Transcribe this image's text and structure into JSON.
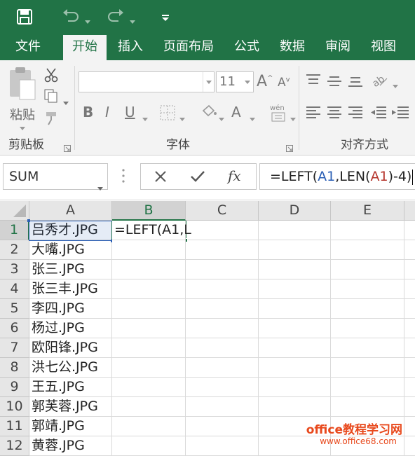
{
  "menu": {
    "tabs": [
      {
        "label": "文件"
      },
      {
        "label": "开始"
      },
      {
        "label": "插入"
      },
      {
        "label": "页面布局"
      },
      {
        "label": "公式"
      },
      {
        "label": "数据"
      },
      {
        "label": "审阅"
      },
      {
        "label": "视图"
      }
    ],
    "active": "开始"
  },
  "ribbon": {
    "clipboard": {
      "paste_label": "粘贴",
      "group_label": "剪贴板"
    },
    "font": {
      "font_name": "",
      "font_size": "11",
      "group_label": "字体"
    },
    "alignment": {
      "group_label": "对齐方式"
    }
  },
  "formula_bar": {
    "name_box": "SUM",
    "formula_parts": [
      "=LEFT(",
      "A1",
      ",LEN(",
      "A1",
      ")-4)"
    ]
  },
  "sheet": {
    "columns": [
      "A",
      "B",
      "C",
      "D",
      "E"
    ],
    "selected_column": "B",
    "rows": [
      {
        "num": "1",
        "a": "吕秀才.JPG",
        "b": "=LEFT(A1,L"
      },
      {
        "num": "2",
        "a": "大嘴.JPG",
        "b": ""
      },
      {
        "num": "3",
        "a": "张三.JPG",
        "b": ""
      },
      {
        "num": "4",
        "a": "张三丰.JPG",
        "b": ""
      },
      {
        "num": "5",
        "a": "李四.JPG",
        "b": ""
      },
      {
        "num": "6",
        "a": "杨过.JPG",
        "b": ""
      },
      {
        "num": "7",
        "a": "欧阳锋.JPG",
        "b": ""
      },
      {
        "num": "8",
        "a": "洪七公.JPG",
        "b": ""
      },
      {
        "num": "9",
        "a": "王五.JPG",
        "b": ""
      },
      {
        "num": "10",
        "a": "郭芙蓉.JPG",
        "b": ""
      },
      {
        "num": "11",
        "a": "郭靖.JPG",
        "b": ""
      },
      {
        "num": "12",
        "a": "黄蓉.JPG",
        "b": ""
      }
    ]
  },
  "watermark": {
    "line1": "office教程学习网",
    "line2": "www.office68.com"
  },
  "colors": {
    "accent": "#217346",
    "ref_blue": "#2b5fb5",
    "ref_red": "#b5342b",
    "watermark": "#e8491d"
  }
}
